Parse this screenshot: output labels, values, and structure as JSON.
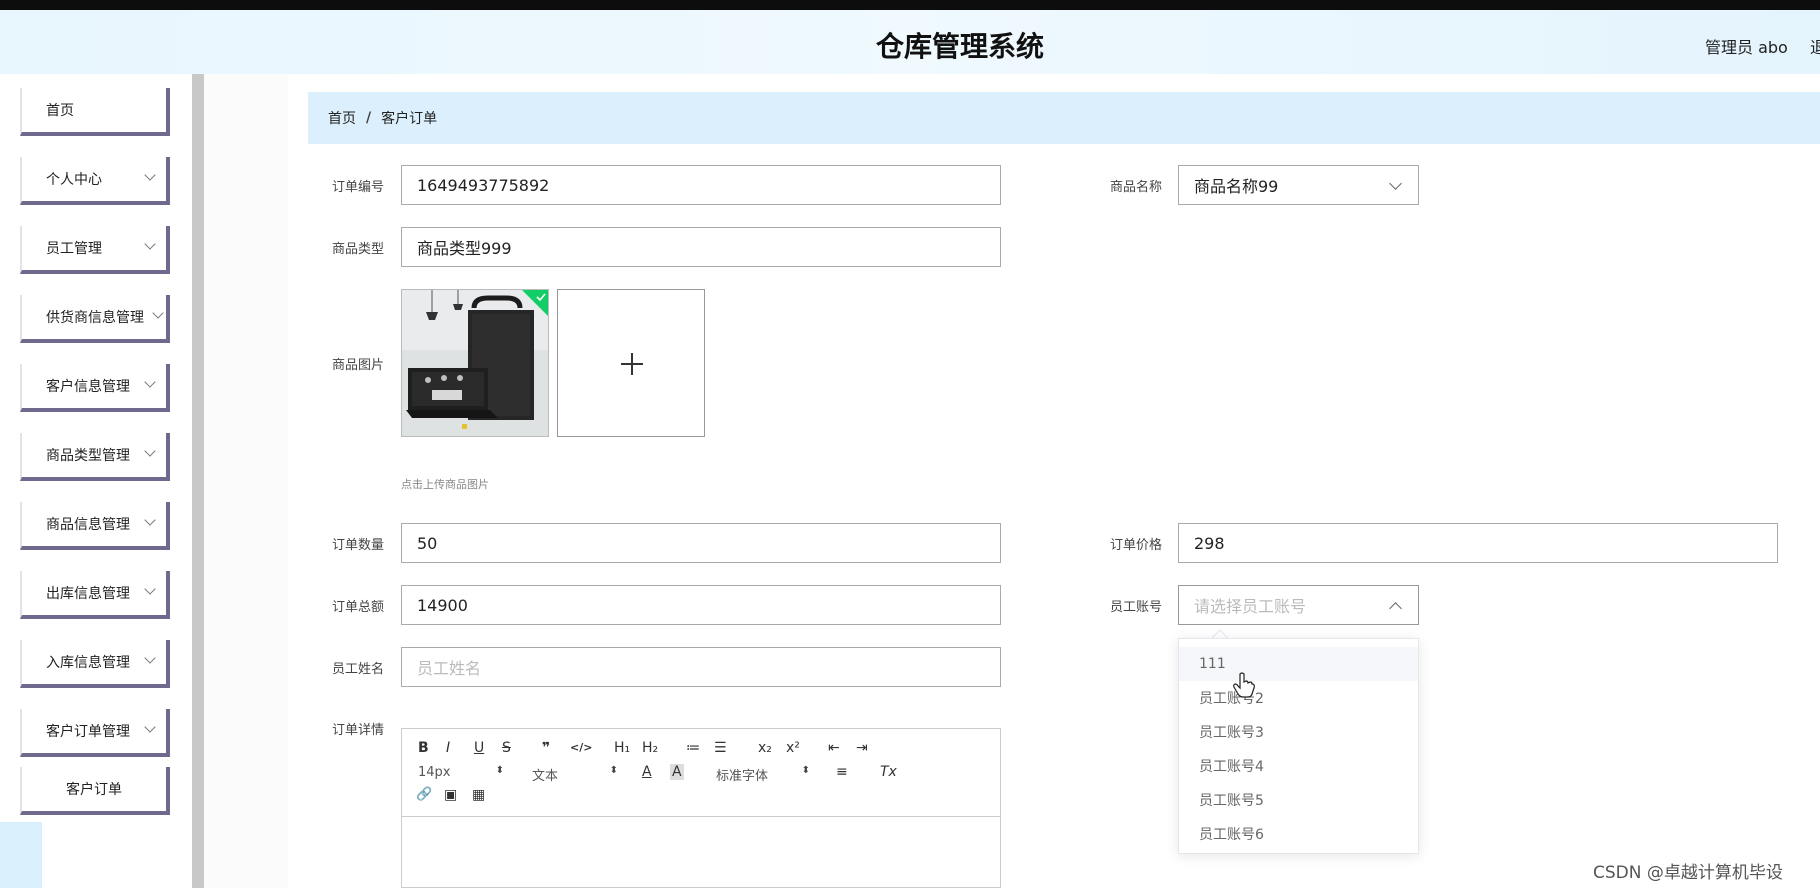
{
  "header": {
    "title": "仓库管理系统",
    "user": "管理员 abo",
    "logout": "退"
  },
  "sidebar": {
    "items": [
      {
        "label": "首页"
      },
      {
        "label": "个人中心"
      },
      {
        "label": "员工管理"
      },
      {
        "label": "供货商信息管理"
      },
      {
        "label": "客户信息管理"
      },
      {
        "label": "商品类型管理"
      },
      {
        "label": "商品信息管理"
      },
      {
        "label": "出库信息管理"
      },
      {
        "label": "入库信息管理"
      },
      {
        "label": "客户订单管理"
      }
    ],
    "sub_item": "客户订单"
  },
  "breadcrumb": {
    "home": "首页",
    "separator": "/",
    "current": "客户订单"
  },
  "form": {
    "order_no": {
      "label": "订单编号",
      "value": "1649493775892"
    },
    "product_name": {
      "label": "商品名称",
      "value": "商品名称99"
    },
    "product_type": {
      "label": "商品类型",
      "value": "商品类型999"
    },
    "product_image": {
      "label": "商品图片",
      "hint": "点击上传商品图片",
      "add_symbol": "+"
    },
    "quantity": {
      "label": "订单数量",
      "value": "50"
    },
    "price": {
      "label": "订单价格",
      "value": "298"
    },
    "total": {
      "label": "订单总额",
      "value": "14900"
    },
    "employee_account": {
      "label": "员工账号",
      "placeholder": "请选择员工账号"
    },
    "employee_name": {
      "label": "员工姓名",
      "placeholder": "员工姓名"
    },
    "details": {
      "label": "订单详情"
    }
  },
  "editor": {
    "font_size": "14px",
    "paragraph": "文本",
    "font_family": "标准字体",
    "buttons": {
      "bold": "B",
      "italic": "I",
      "underline": "U",
      "strike": "S",
      "quote": "❞",
      "code": "</>",
      "h1": "H₁",
      "h2": "H₂",
      "ordered_list": "≔",
      "bullet_list": "☰",
      "subscript": "x₂",
      "superscript": "x²",
      "outdent": "⇤",
      "indent": "⇥",
      "color": "A",
      "background": "A",
      "align": "≡",
      "clean": "Tx",
      "link": "🔗",
      "image": "▣",
      "video": "▦",
      "updown": "⬍"
    }
  },
  "dropdown": {
    "options": [
      "111",
      "员工账号2",
      "员工账号3",
      "员工账号4",
      "员工账号5",
      "员工账号6"
    ]
  },
  "watermark": "CSDN @卓越计算机毕设",
  "colors": {
    "header_bg": "#e8f6fe",
    "breadcrumb_bg": "#dbf0fc",
    "menu_border": "#6e6a8e",
    "upload_success": "#13ce66"
  }
}
